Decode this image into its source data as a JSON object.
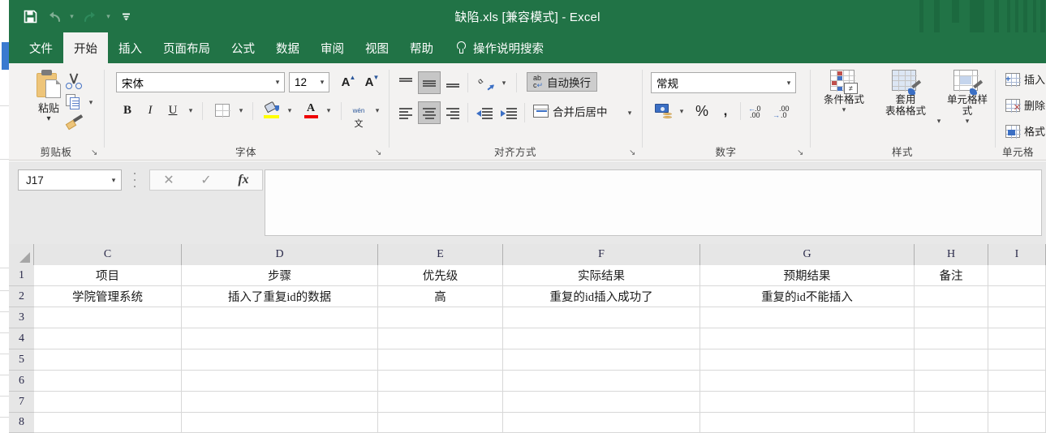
{
  "window": {
    "title": "缺陷.xls [兼容模式]  -  Excel",
    "accent_color": "#217346"
  },
  "quick_access": {
    "save_icon": "save-icon",
    "undo_icon": "undo-icon",
    "redo_icon": "redo-icon",
    "customize_icon": "customize-qat-icon"
  },
  "tabs": [
    {
      "label": "文件",
      "active": false
    },
    {
      "label": "开始",
      "active": true
    },
    {
      "label": "插入",
      "active": false
    },
    {
      "label": "页面布局",
      "active": false
    },
    {
      "label": "公式",
      "active": false
    },
    {
      "label": "数据",
      "active": false
    },
    {
      "label": "审阅",
      "active": false
    },
    {
      "label": "视图",
      "active": false
    },
    {
      "label": "帮助",
      "active": false
    }
  ],
  "tell_me": {
    "icon": "lightbulb-icon",
    "label": "操作说明搜索"
  },
  "ribbon": {
    "clipboard": {
      "group_label": "剪贴板",
      "paste_label": "粘贴",
      "cut_label": "",
      "copy_label": "",
      "format_painter_label": "",
      "dialog_launcher": "↘"
    },
    "font": {
      "group_label": "字体",
      "font_name": "宋体",
      "font_size": "12",
      "grow_label": "A",
      "shrink_label": "A",
      "bold_label": "B",
      "italic_label": "I",
      "underline_label": "U",
      "phonetic_top": "wén",
      "phonetic_bottom": "文",
      "dialog_launcher": "↘"
    },
    "alignment": {
      "group_label": "对齐方式",
      "wrap_text_label": "自动换行",
      "wrap_text_glyph_top": "ab",
      "wrap_text_glyph_bottom": "c",
      "merge_center_label": "合并后居中",
      "dialog_launcher": "↘"
    },
    "number": {
      "group_label": "数字",
      "format_value": "常规",
      "percent_label": "%",
      "comma_label": ",",
      "increase_decimal": ".00",
      "decrease_decimal": ".00",
      "dialog_launcher": "↘"
    },
    "styles": {
      "group_label": "样式",
      "conditional_label": "条件格式",
      "conditional_glyph": "≠",
      "table_label_line1": "套用",
      "table_label_line2": "表格格式",
      "cellstyle_label": "单元格样式"
    },
    "cells": {
      "group_label": "单元格",
      "insert_label": "插入",
      "delete_label": "删除",
      "format_label": "格式"
    }
  },
  "formula_bar": {
    "name_box_value": "J17",
    "cancel_icon": "cancel-icon",
    "confirm_icon": "confirm-icon",
    "function_icon": "fx",
    "input_value": ""
  },
  "sheet": {
    "columns": [
      "C",
      "D",
      "E",
      "F",
      "G",
      "H",
      "I"
    ],
    "rows": [
      "1",
      "2",
      "3",
      "4",
      "5",
      "6",
      "7",
      "8"
    ],
    "cells": {
      "row1": {
        "C": "项目",
        "D": "步骤",
        "E": "优先级",
        "F": "实际结果",
        "G": "预期结果",
        "H": "备注",
        "I": ""
      },
      "row2": {
        "C": "学院管理系统",
        "D": "插入了重复id的数据",
        "E": "高",
        "F": "重复的id插入成功了",
        "G": "重复的id不能插入",
        "H": "",
        "I": ""
      }
    }
  }
}
